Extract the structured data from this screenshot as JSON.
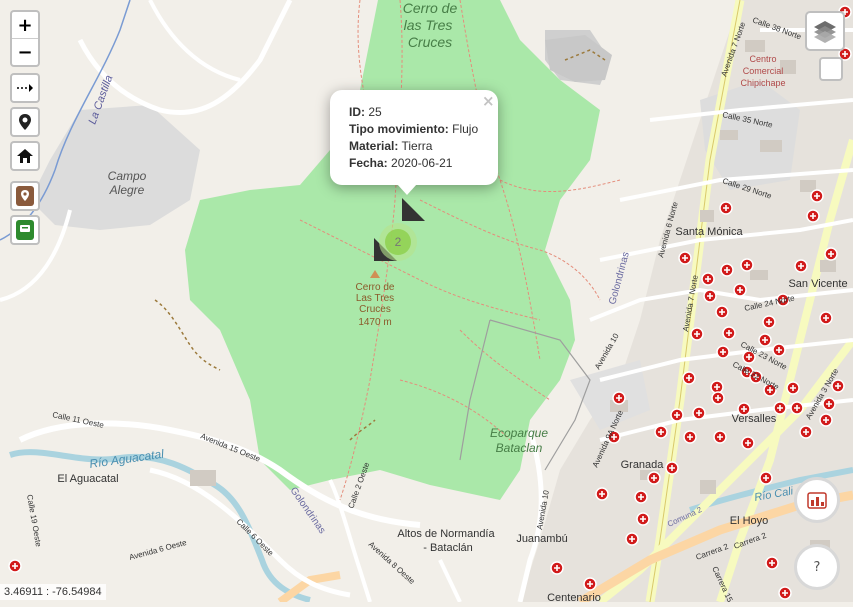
{
  "controls": {
    "zoom_in_label": "+",
    "zoom_out_label": "−",
    "tools": [
      {
        "name": "measure-tool-button",
        "icon": "dashed-arrow-icon"
      },
      {
        "name": "locate-button",
        "icon": "map-pin-icon"
      },
      {
        "name": "home-button",
        "icon": "home-icon"
      },
      {
        "name": "brown-marker-layer-button",
        "icon": "brown-marker-icon"
      },
      {
        "name": "green-marker-layer-button",
        "icon": "green-marker-icon"
      }
    ],
    "layers_icon": "layers-icon",
    "help_label": "?"
  },
  "popup": {
    "id_label": "ID:",
    "id_value": "25",
    "tipo_label": "Tipo movimiento:",
    "tipo_value": "Flujo",
    "material_label": "Material:",
    "material_value": "Tierra",
    "fecha_label": "Fecha:",
    "fecha_value": "2020-06-21",
    "close_label": "×"
  },
  "cluster": {
    "count": "2",
    "color": "#8fd14f"
  },
  "coordinates_readout": "3.46911 : -76.54984",
  "place_labels": {
    "cerro_top_1": "Cerro de",
    "cerro_top_2": "las Tres",
    "cerro_top_3": "Cruces",
    "la_castilla": "La Castilla",
    "campo_1": "Campo",
    "campo_2": "Alegre",
    "cerro_peak_1": "Cerro de",
    "cerro_peak_2": "Las Tres",
    "cerro_peak_3": "Cruces",
    "cerro_peak_4": "1470 m",
    "golondrinas": "Golondrinas",
    "golondrinas_2": "Golondrinas",
    "ecoparque_1": "Ecoparque",
    "ecoparque_2": "Bataclan",
    "santa_monica": "Santa Mónica",
    "san_vicente": "San Vicente",
    "versalles": "Versalles",
    "granada": "Granada",
    "el_hoyo": "El Hoyo",
    "el_aguacatal": "El Aguacatal",
    "rio_aguacatal": "Río Aguacatal",
    "rio_cali": "Río Cali",
    "altos_1": "Altos de Normandía",
    "altos_2": "- Bataclán",
    "juanambu": "Juanambú",
    "centenario": "Centenario",
    "centro_1": "Centro",
    "centro_2": "Comercial",
    "centro_3": "Chipichape",
    "calle_38": "Calle 38 Norte",
    "calle_35": "Calle 35 Norte",
    "calle_29": "Calle 29 Norte",
    "calle_24": "Calle 24 Norte",
    "calle_23": "Calle 23 Norte",
    "calle_22": "Calle 22 Norte",
    "calle_11": "Calle 11 Oeste",
    "calle_6": "Calle 6 Oeste",
    "calle_2": "Calle 2 Oeste",
    "calle_19": "Calle 19 Oeste",
    "carrera_2": "Carrera 2",
    "carrera_15": "Carrera 15",
    "comuna_2": "Comuna 2",
    "av_15": "Avenida 15 Oeste",
    "av_6": "Avenida 6 Oeste",
    "av_8": "Avenida 8 Oeste",
    "av_9an": "Avenida 9A Norte",
    "av_10": "Avenida 10",
    "av_10b": "Avenida 10",
    "av_7n": "Avenida 7 Norte",
    "av_7n_b": "Avenida 7 Norte",
    "av_6n": "Avenida 6 Norte",
    "av_3n": "Avenida 3 Norte",
    "av_4": "Avenida 4"
  },
  "colors": {
    "park_green": "#aae8a9",
    "land": "#f2efe9",
    "road_yellow": "#f7fabf",
    "river_blue": "#aad3df",
    "urban_gray": "#dcdcdc"
  }
}
